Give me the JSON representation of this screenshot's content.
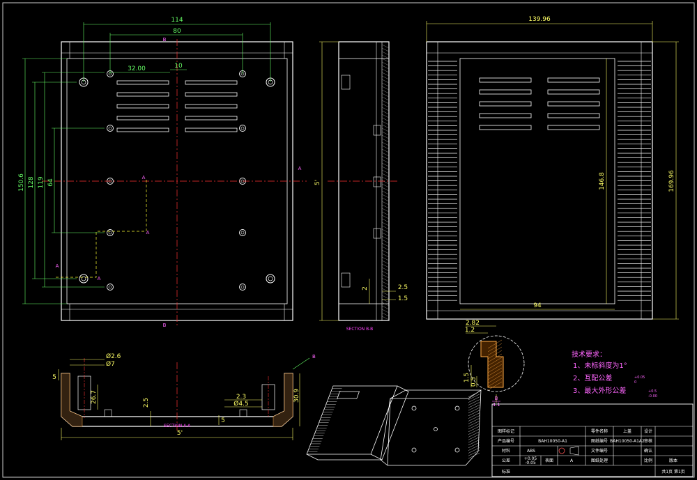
{
  "front_view": {
    "dims": {
      "w114": "114",
      "w80": "80",
      "w32": "32.00",
      "w10": "10",
      "h150": "150.6",
      "h128": "128",
      "h119": "119",
      "h64": "64"
    },
    "labels": {
      "b_top": "B",
      "b_bottom": "B",
      "a_mid": "A",
      "a_right": "A",
      "a_left": "A",
      "a_low": "A",
      "a_center": "A"
    }
  },
  "side_view": {
    "dims": {
      "h5": "5'",
      "d25": "2.5",
      "d15": "1.5",
      "d2": "2"
    },
    "section_label": "SECTION B-B"
  },
  "top_view": {
    "dims": {
      "w139": "139.96",
      "h169": "169.96",
      "h146": "146.8",
      "w94": "94"
    }
  },
  "section_aa": {
    "label": "SECTION A-A",
    "dims": {
      "d26": "Ø2.6",
      "d7": "Ø7",
      "h5": "5",
      "h25": "2.5",
      "h30": "30.9",
      "d23": "2.3",
      "d45": "Ø4.5",
      "h26": "26.7",
      "h5b": "5",
      "w5": "5'",
      "b": "B"
    }
  },
  "detail_b": {
    "dims": {
      "d282": "2.82",
      "d12": "1.2",
      "d15": "1.5",
      "d05": "0.5"
    },
    "label": "B",
    "scale": "4:1"
  },
  "notes": {
    "title": "技术要求：",
    "items": [
      "1、未标斜度为1°",
      "2、互配公差",
      "3、最大外形公差"
    ],
    "tol1": "+0.05",
    "tol2": "0",
    "tol3": "+0.5",
    "tol4": "-0.00"
  },
  "title_block": {
    "r1c1": "图样标记",
    "r1c2": "零件名称",
    "r1c3": "上盖",
    "r1c4": "设计",
    "r2c1": "产品编号",
    "r2c2": "BAH10050-A1",
    "r2c3": "图纸编号",
    "r2c4": "BAH10050-A1A2",
    "r2c5": "审核",
    "r3c1": "材料",
    "r3c2": "ABS",
    "r3c3": "文件编号",
    "r3c4": "确认",
    "r4c1": "公差",
    "r4c2": "+0.05",
    "r4c3": "-0.05",
    "r4c4": "表面",
    "r4c5": "A",
    "r4c6": "图纸处理",
    "r4c7": "比例",
    "r5c1": "标准",
    "r5c2": "共1页 第1页",
    "r5c3": "版本"
  }
}
